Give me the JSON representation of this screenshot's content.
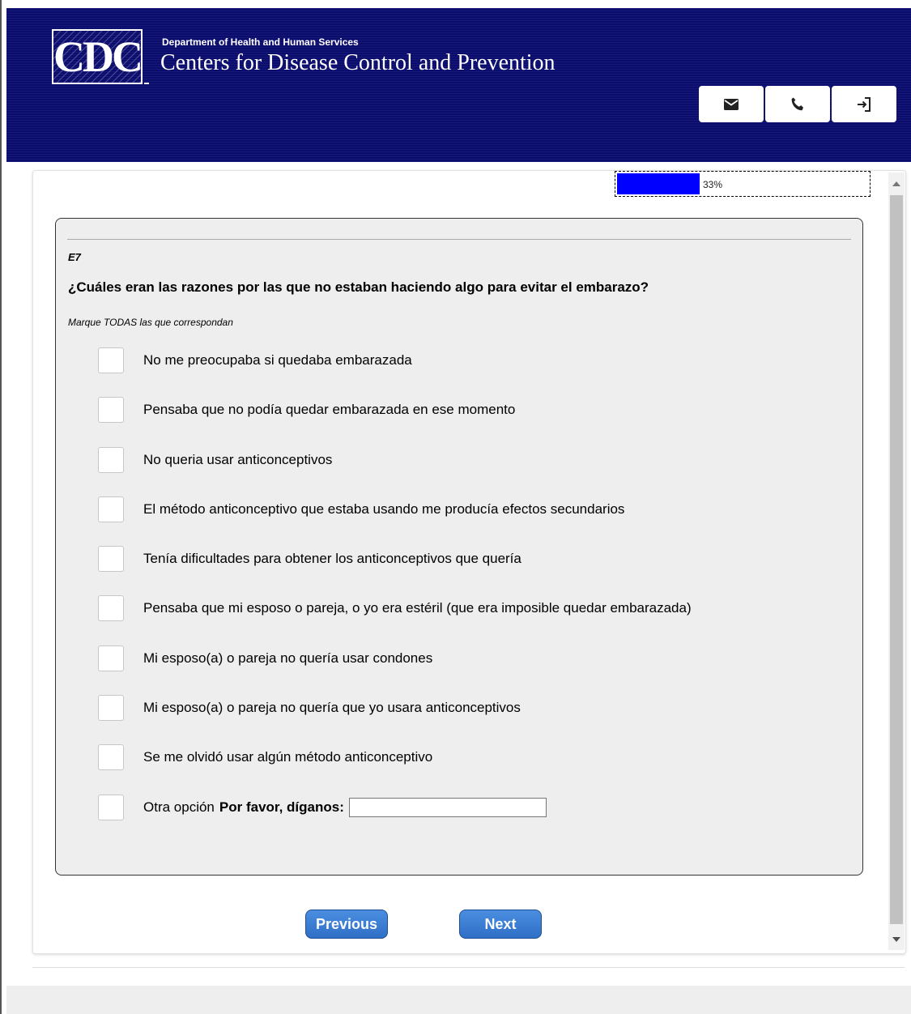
{
  "header": {
    "logo_text": "CDC",
    "department": "Department of Health and Human Services",
    "agency": "Centers for Disease Control and Prevention",
    "icons": [
      "mail-icon",
      "phone-icon",
      "exit-icon"
    ]
  },
  "progress": {
    "percent": 33,
    "label": "33%",
    "color": "#0000ff"
  },
  "question": {
    "id": "E7",
    "text": "¿Cuáles eran las razones por las que no estaban haciendo algo para evitar el embarazo?",
    "instruction": "Marque TODAS las que correspondan",
    "options": [
      {
        "label": "No me preocupaba si quedaba embarazada"
      },
      {
        "label": "Pensaba que no podía quedar embarazada en ese momento"
      },
      {
        "label": "No queria usar anticonceptivos"
      },
      {
        "label": "El método anticonceptivo que estaba usando me producía efectos secundarios"
      },
      {
        "label": "Tenía dificultades para obtener los anticonceptivos que quería"
      },
      {
        "label": "Pensaba que mi esposo o pareja, o yo era estéril (que era imposible quedar embarazada)"
      },
      {
        "label": "Mi esposo(a) o pareja no quería usar condones"
      },
      {
        "label": "Mi esposo(a) o pareja no quería que yo usara anticonceptivos"
      },
      {
        "label": "Se me olvidó usar algún método anticonceptivo"
      },
      {
        "label": "Otra opción",
        "specify_label": "Por favor, díganos:",
        "specify_value": ""
      }
    ]
  },
  "nav": {
    "previous_label": "Previous",
    "next_label": "Next"
  },
  "colors": {
    "header_bg": "#0b0d6e",
    "button_bg": "#3a7bd5",
    "progress_fill": "#0000ff"
  }
}
